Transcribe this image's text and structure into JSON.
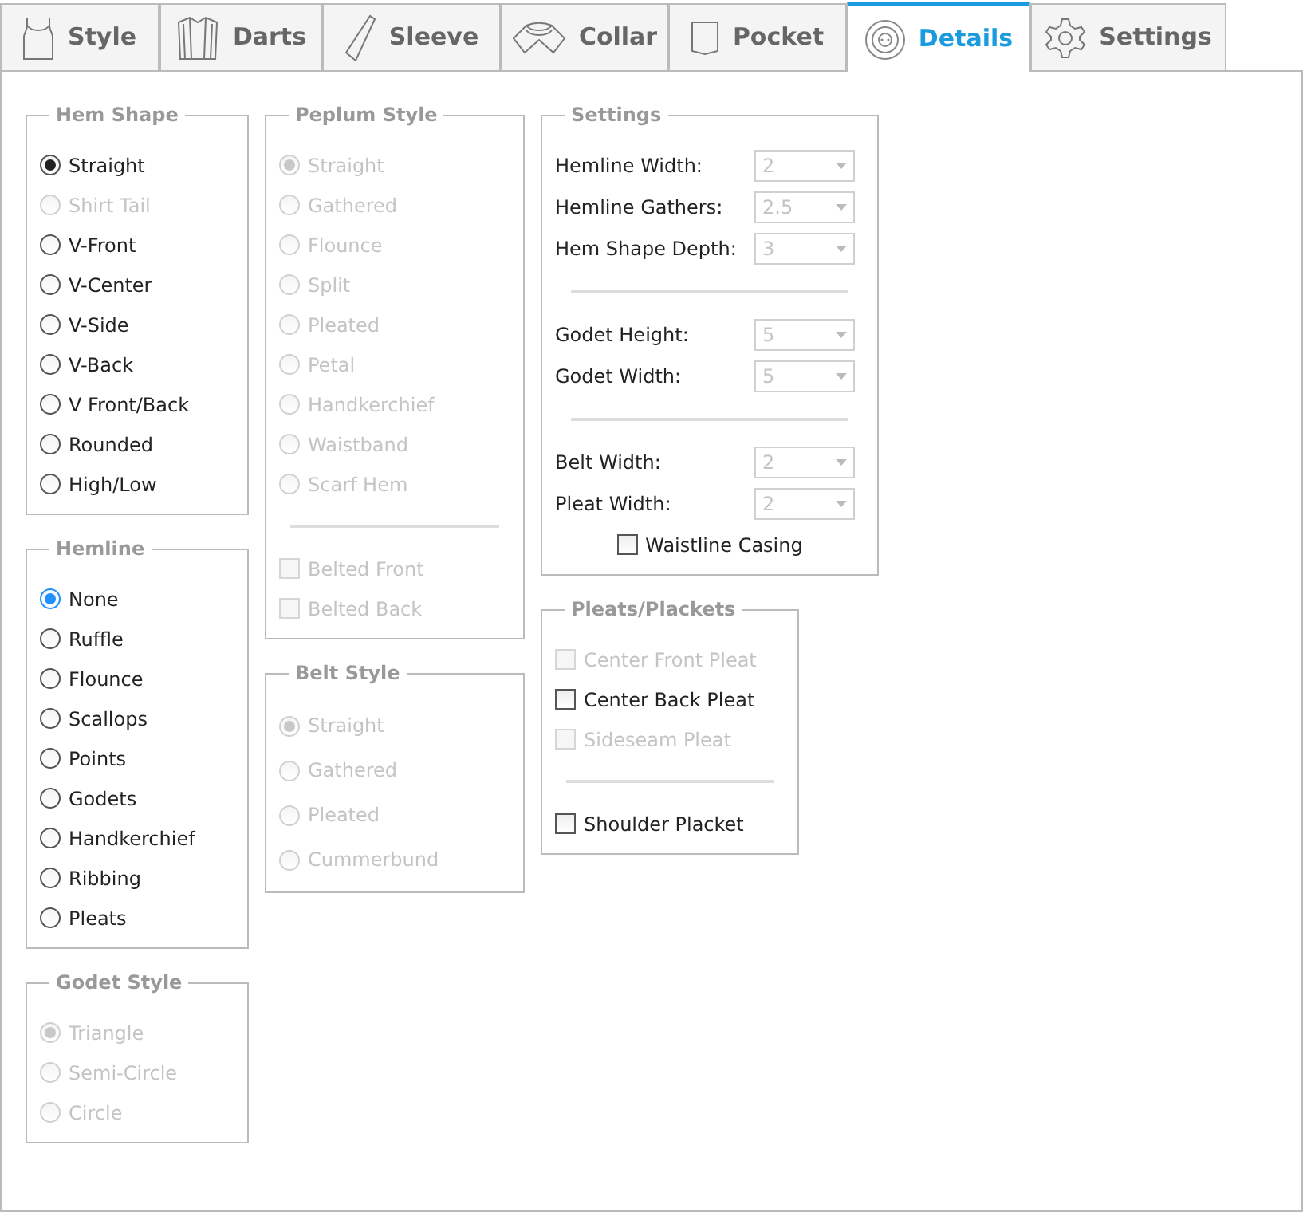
{
  "tabs": [
    {
      "label": "Style",
      "selected": false
    },
    {
      "label": "Darts",
      "selected": false
    },
    {
      "label": "Sleeve",
      "selected": false
    },
    {
      "label": "Collar",
      "selected": false
    },
    {
      "label": "Pocket",
      "selected": false
    },
    {
      "label": "Details",
      "selected": true
    },
    {
      "label": "Settings",
      "selected": false
    }
  ],
  "columns": [
    [
      {
        "title": "Hem Shape",
        "items": [
          {
            "kind": "radio",
            "label": "Straight",
            "selected": true,
            "disabled": false
          },
          {
            "kind": "radio",
            "label": "Shirt Tail",
            "selected": false,
            "disabled": true
          },
          {
            "kind": "radio",
            "label": "V-Front",
            "selected": false,
            "disabled": false
          },
          {
            "kind": "radio",
            "label": "V-Center",
            "selected": false,
            "disabled": false
          },
          {
            "kind": "radio",
            "label": "V-Side",
            "selected": false,
            "disabled": false
          },
          {
            "kind": "radio",
            "label": "V-Back",
            "selected": false,
            "disabled": false
          },
          {
            "kind": "radio",
            "label": "V Front/Back",
            "selected": false,
            "disabled": false
          },
          {
            "kind": "radio",
            "label": "Rounded",
            "selected": false,
            "disabled": false
          },
          {
            "kind": "radio",
            "label": "High/Low",
            "selected": false,
            "disabled": false
          }
        ]
      },
      {
        "title": "Hemline",
        "items": [
          {
            "kind": "radio",
            "label": "None",
            "selected": true,
            "disabled": false,
            "focused": true
          },
          {
            "kind": "radio",
            "label": "Ruffle",
            "selected": false,
            "disabled": false,
            "focused": false
          },
          {
            "kind": "radio",
            "label": "Flounce",
            "selected": false,
            "disabled": false,
            "focused": false
          },
          {
            "kind": "radio",
            "label": "Scallops",
            "selected": false,
            "disabled": false,
            "focused": false
          },
          {
            "kind": "radio",
            "label": "Points",
            "selected": false,
            "disabled": false,
            "focused": false
          },
          {
            "kind": "radio",
            "label": "Godets",
            "selected": false,
            "disabled": false,
            "focused": false
          },
          {
            "kind": "radio",
            "label": "Handkerchief",
            "selected": false,
            "disabled": false,
            "focused": false
          },
          {
            "kind": "radio",
            "label": "Ribbing",
            "selected": false,
            "disabled": false,
            "focused": false
          },
          {
            "kind": "radio",
            "label": "Pleats",
            "selected": false,
            "disabled": false,
            "focused": false
          }
        ]
      },
      {
        "title": "Godet Style",
        "items": [
          {
            "kind": "radio",
            "label": "Triangle",
            "selected": true,
            "disabled": true
          },
          {
            "kind": "radio",
            "label": "Semi-Circle",
            "selected": false,
            "disabled": true
          },
          {
            "kind": "radio",
            "label": "Circle",
            "selected": false,
            "disabled": true
          }
        ]
      }
    ],
    [
      {
        "title": "Peplum Style",
        "items": [
          {
            "kind": "radio",
            "label": "Straight",
            "selected": true,
            "disabled": true
          },
          {
            "kind": "radio",
            "label": "Gathered",
            "selected": false,
            "disabled": true
          },
          {
            "kind": "radio",
            "label": "Flounce",
            "selected": false,
            "disabled": true
          },
          {
            "kind": "radio",
            "label": "Split",
            "selected": false,
            "disabled": true
          },
          {
            "kind": "radio",
            "label": "Pleated",
            "selected": false,
            "disabled": true
          },
          {
            "kind": "radio",
            "label": "Petal",
            "selected": false,
            "disabled": true
          },
          {
            "kind": "radio",
            "label": "Handkerchief",
            "selected": false,
            "disabled": true
          },
          {
            "kind": "radio",
            "label": "Waistband",
            "selected": false,
            "disabled": true
          },
          {
            "kind": "radio",
            "label": "Scarf Hem",
            "selected": false,
            "disabled": true
          },
          {
            "kind": "divider"
          },
          {
            "kind": "checkbox",
            "label": "Belted Front",
            "checked": false,
            "disabled": true
          },
          {
            "kind": "checkbox",
            "label": "Belted Back",
            "checked": false,
            "disabled": true
          }
        ]
      },
      {
        "title": "Belt Style",
        "items": [
          {
            "kind": "radio",
            "label": "Straight",
            "selected": true,
            "disabled": true
          },
          {
            "kind": "radio",
            "label": "Gathered",
            "selected": false,
            "disabled": true
          },
          {
            "kind": "radio",
            "label": "Pleated",
            "selected": false,
            "disabled": true
          },
          {
            "kind": "radio",
            "label": "Cummerbund",
            "selected": false,
            "disabled": true
          }
        ]
      }
    ],
    [
      {
        "title": "Settings",
        "items": [
          {
            "kind": "dropdown",
            "label": "Hemline Width:",
            "value": "2",
            "disabled": true
          },
          {
            "kind": "dropdown",
            "label": "Hemline Gathers:",
            "value": "2.5",
            "disabled": true
          },
          {
            "kind": "dropdown",
            "label": "Hem Shape Depth:",
            "value": "3",
            "disabled": true
          },
          {
            "kind": "divider"
          },
          {
            "kind": "dropdown",
            "label": "Godet Height:",
            "value": "5",
            "disabled": true
          },
          {
            "kind": "dropdown",
            "label": "Godet Width:",
            "value": "5",
            "disabled": true
          },
          {
            "kind": "divider"
          },
          {
            "kind": "dropdown",
            "label": "Belt Width:",
            "value": "2",
            "disabled": true
          },
          {
            "kind": "dropdown",
            "label": "Pleat Width:",
            "value": "2",
            "disabled": true
          },
          {
            "kind": "checkbox",
            "label": "Waistline Casing",
            "checked": false,
            "disabled": false
          }
        ]
      },
      {
        "title": "Pleats/Plackets",
        "items": [
          {
            "kind": "checkbox",
            "label": "Center Front Pleat",
            "checked": false,
            "disabled": true
          },
          {
            "kind": "checkbox",
            "label": "Center Back Pleat",
            "checked": false,
            "disabled": false
          },
          {
            "kind": "checkbox",
            "label": "Sideseam Pleat",
            "checked": false,
            "disabled": true
          },
          {
            "kind": "divider"
          },
          {
            "kind": "checkbox",
            "label": "Shoulder Placket",
            "checked": false,
            "disabled": false
          }
        ]
      }
    ]
  ]
}
